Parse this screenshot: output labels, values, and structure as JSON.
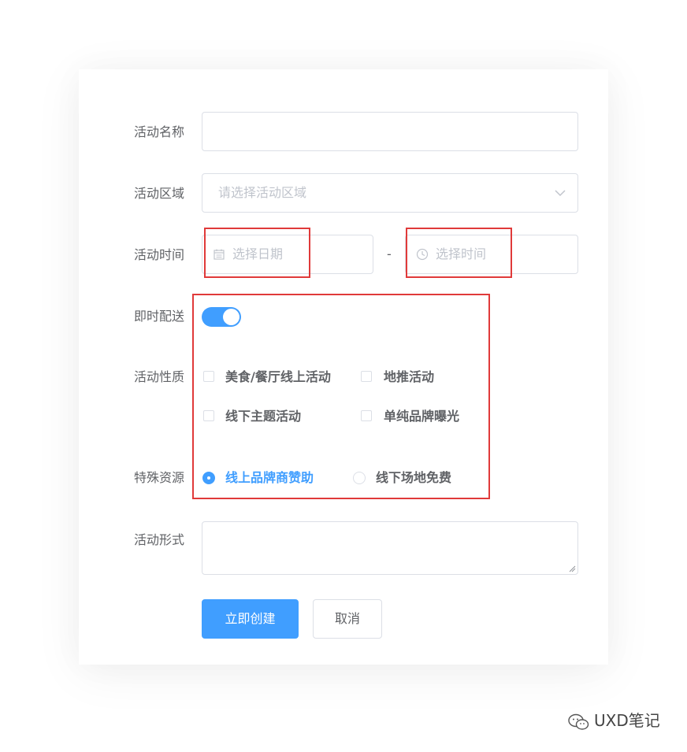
{
  "form": {
    "name": {
      "label": "活动名称",
      "value": ""
    },
    "region": {
      "label": "活动区域",
      "placeholder": "请选择活动区域"
    },
    "time": {
      "label": "活动时间",
      "date_placeholder": "选择日期",
      "separator": "-",
      "time_placeholder": "选择时间"
    },
    "delivery": {
      "label": "即时配送",
      "checked": true
    },
    "nature": {
      "label": "活动性质",
      "options": [
        {
          "label": "美食/餐厅线上活动",
          "checked": false
        },
        {
          "label": "地推活动",
          "checked": false
        },
        {
          "label": "线下主题活动",
          "checked": false
        },
        {
          "label": "单纯品牌曝光",
          "checked": false
        }
      ]
    },
    "resource": {
      "label": "特殊资源",
      "options": [
        {
          "label": "线上品牌商赞助",
          "selected": true
        },
        {
          "label": "线下场地免费",
          "selected": false
        }
      ]
    },
    "format": {
      "label": "活动形式",
      "value": ""
    }
  },
  "buttons": {
    "create": "立即创建",
    "cancel": "取消"
  },
  "watermark": {
    "text": "UXD笔记"
  },
  "colors": {
    "primary": "#409eff",
    "annotation": "#e03a3a",
    "border": "#dcdfe6",
    "placeholder": "#c0c4cc"
  }
}
